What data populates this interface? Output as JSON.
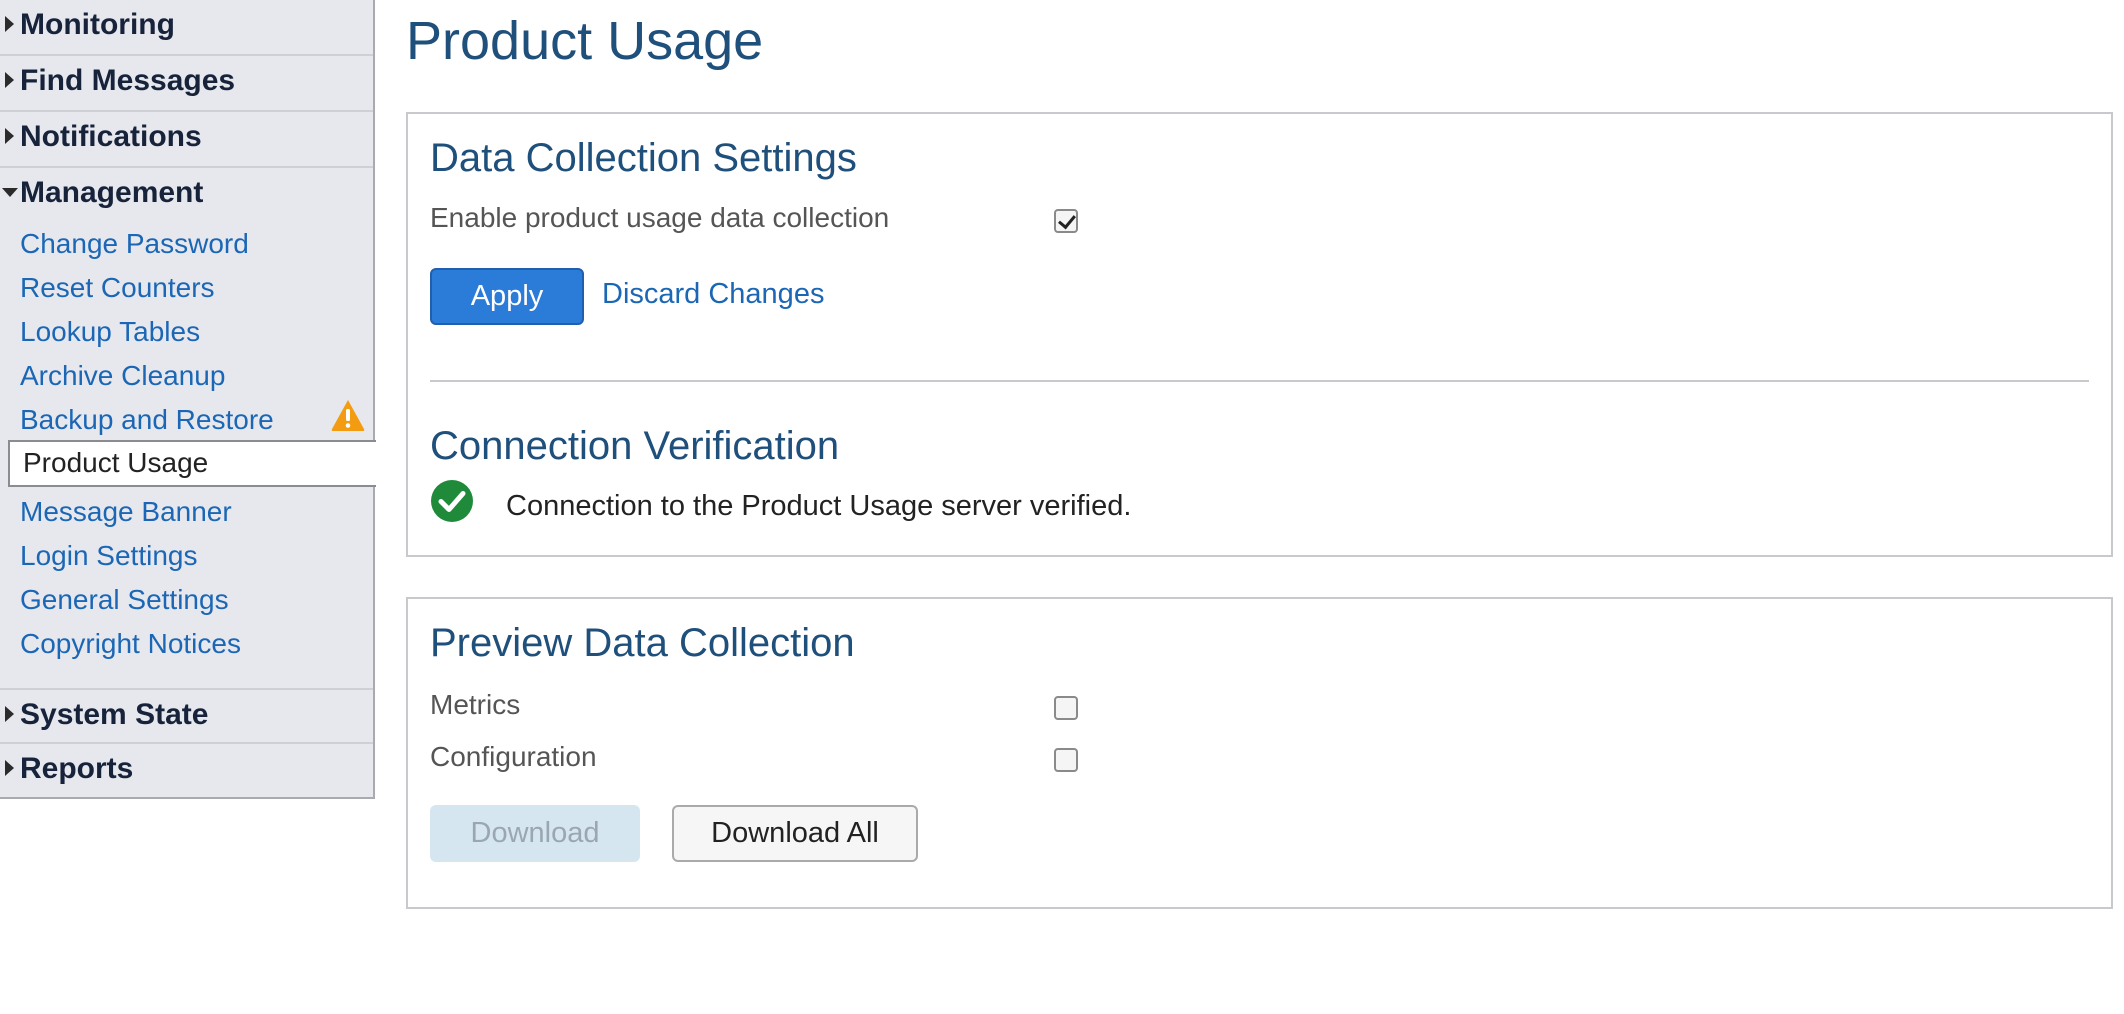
{
  "sidebar": {
    "sections_top": [
      {
        "label": "Monitoring"
      },
      {
        "label": "Find Messages"
      },
      {
        "label": "Notifications"
      }
    ],
    "management": {
      "label": "Management",
      "items": [
        {
          "label": "Change Password"
        },
        {
          "label": "Reset Counters"
        },
        {
          "label": "Lookup Tables"
        },
        {
          "label": "Archive Cleanup"
        },
        {
          "label": "Backup and Restore",
          "icon": "warning-icon"
        },
        {
          "label": "Product Usage",
          "active": true
        },
        {
          "label": "Message Banner"
        },
        {
          "label": "Login Settings"
        },
        {
          "label": "General Settings"
        },
        {
          "label": "Copyright Notices"
        }
      ]
    },
    "sections_bottom": [
      {
        "label": "System State"
      },
      {
        "label": "Reports"
      }
    ]
  },
  "main": {
    "page_title": "Product Usage",
    "data_collection": {
      "heading": "Data Collection Settings",
      "enable_label": "Enable product usage data collection",
      "enable_checked": true,
      "apply_label": "Apply",
      "discard_label": "Discard Changes"
    },
    "connection": {
      "heading": "Connection Verification",
      "status_icon": "check-circle-icon",
      "status_text": "Connection to the Product Usage server verified."
    },
    "preview": {
      "heading": "Preview Data Collection",
      "metrics_label": "Metrics",
      "metrics_checked": false,
      "configuration_label": "Configuration",
      "configuration_checked": false,
      "download_label": "Download",
      "download_all_label": "Download All"
    }
  },
  "colors": {
    "accent": "#2b7bd9",
    "link": "#1b67b5",
    "heading": "#1f4f7b",
    "warning": "#f39c12",
    "success": "#1e8a3a"
  }
}
